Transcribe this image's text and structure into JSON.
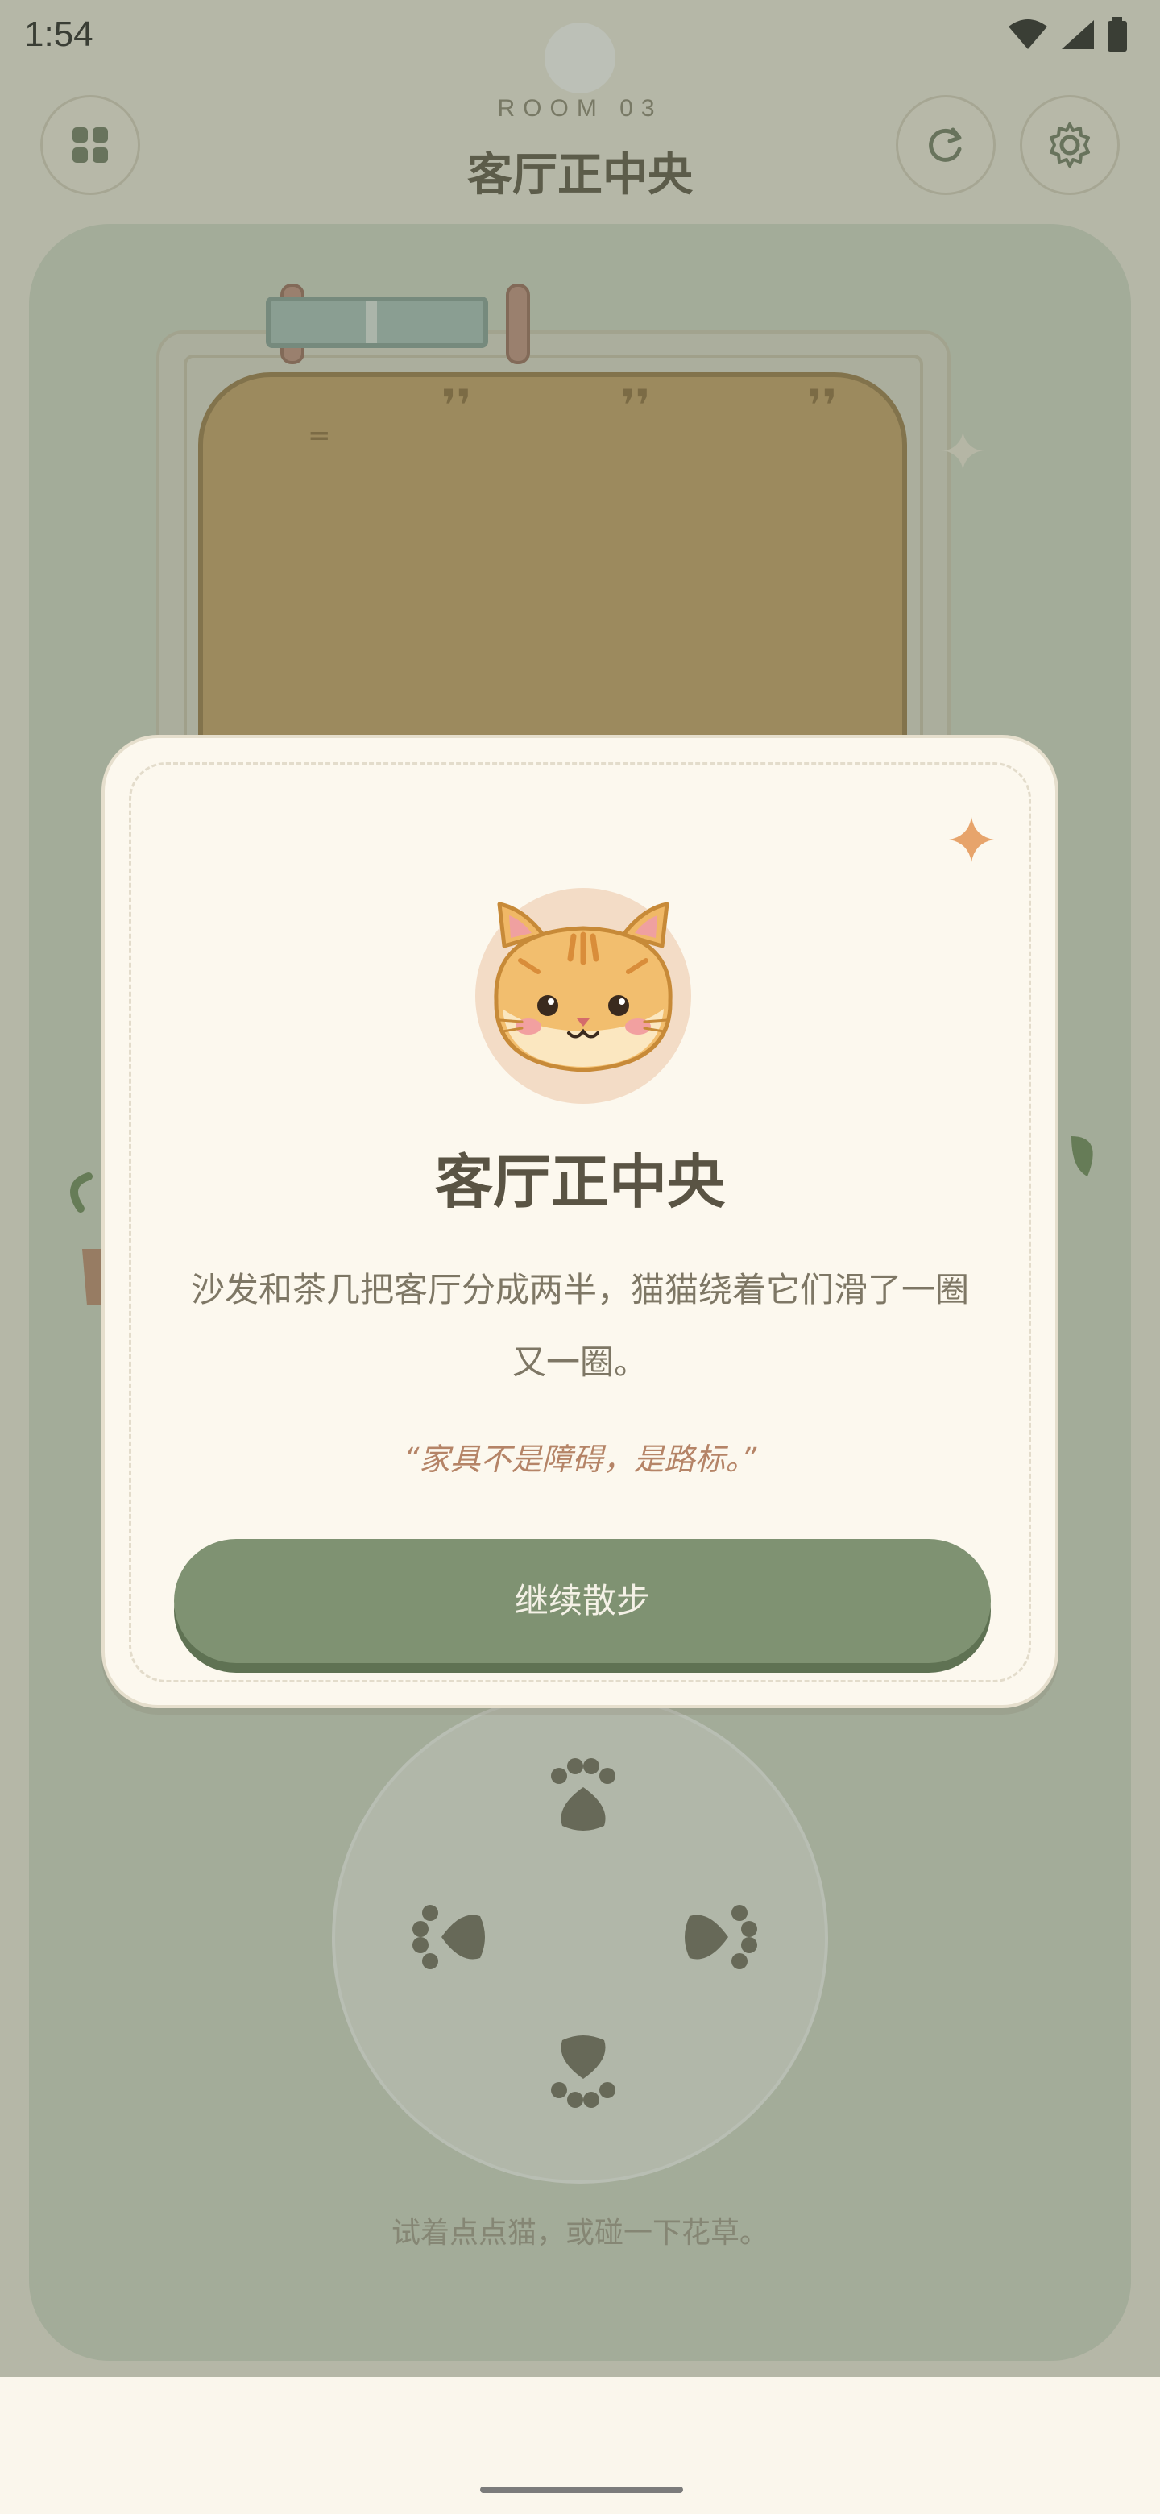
{
  "status_bar": {
    "time": "1:54"
  },
  "header": {
    "room_code": "ROOM 03",
    "room_title": "客厅正中央",
    "menu_icon": "grid-icon",
    "refresh_icon": "refresh-icon",
    "settings_icon": "gear-icon"
  },
  "stage": {
    "hint": "试着点点猫，或碰一下花草。"
  },
  "dialog": {
    "title": "客厅正中央",
    "body": "沙发和茶几把客厅分成两半，猫猫绕着它们滑了一圈又一圈。",
    "quote": "“家具不是障碍，是路标。”",
    "continue_label": "继续散步",
    "avatar": "cat-face-icon"
  },
  "colors": {
    "accent": "#7f9272",
    "title": "#5a5444",
    "quote": "#b58467",
    "dialog_bg": "#fcf8ee"
  }
}
